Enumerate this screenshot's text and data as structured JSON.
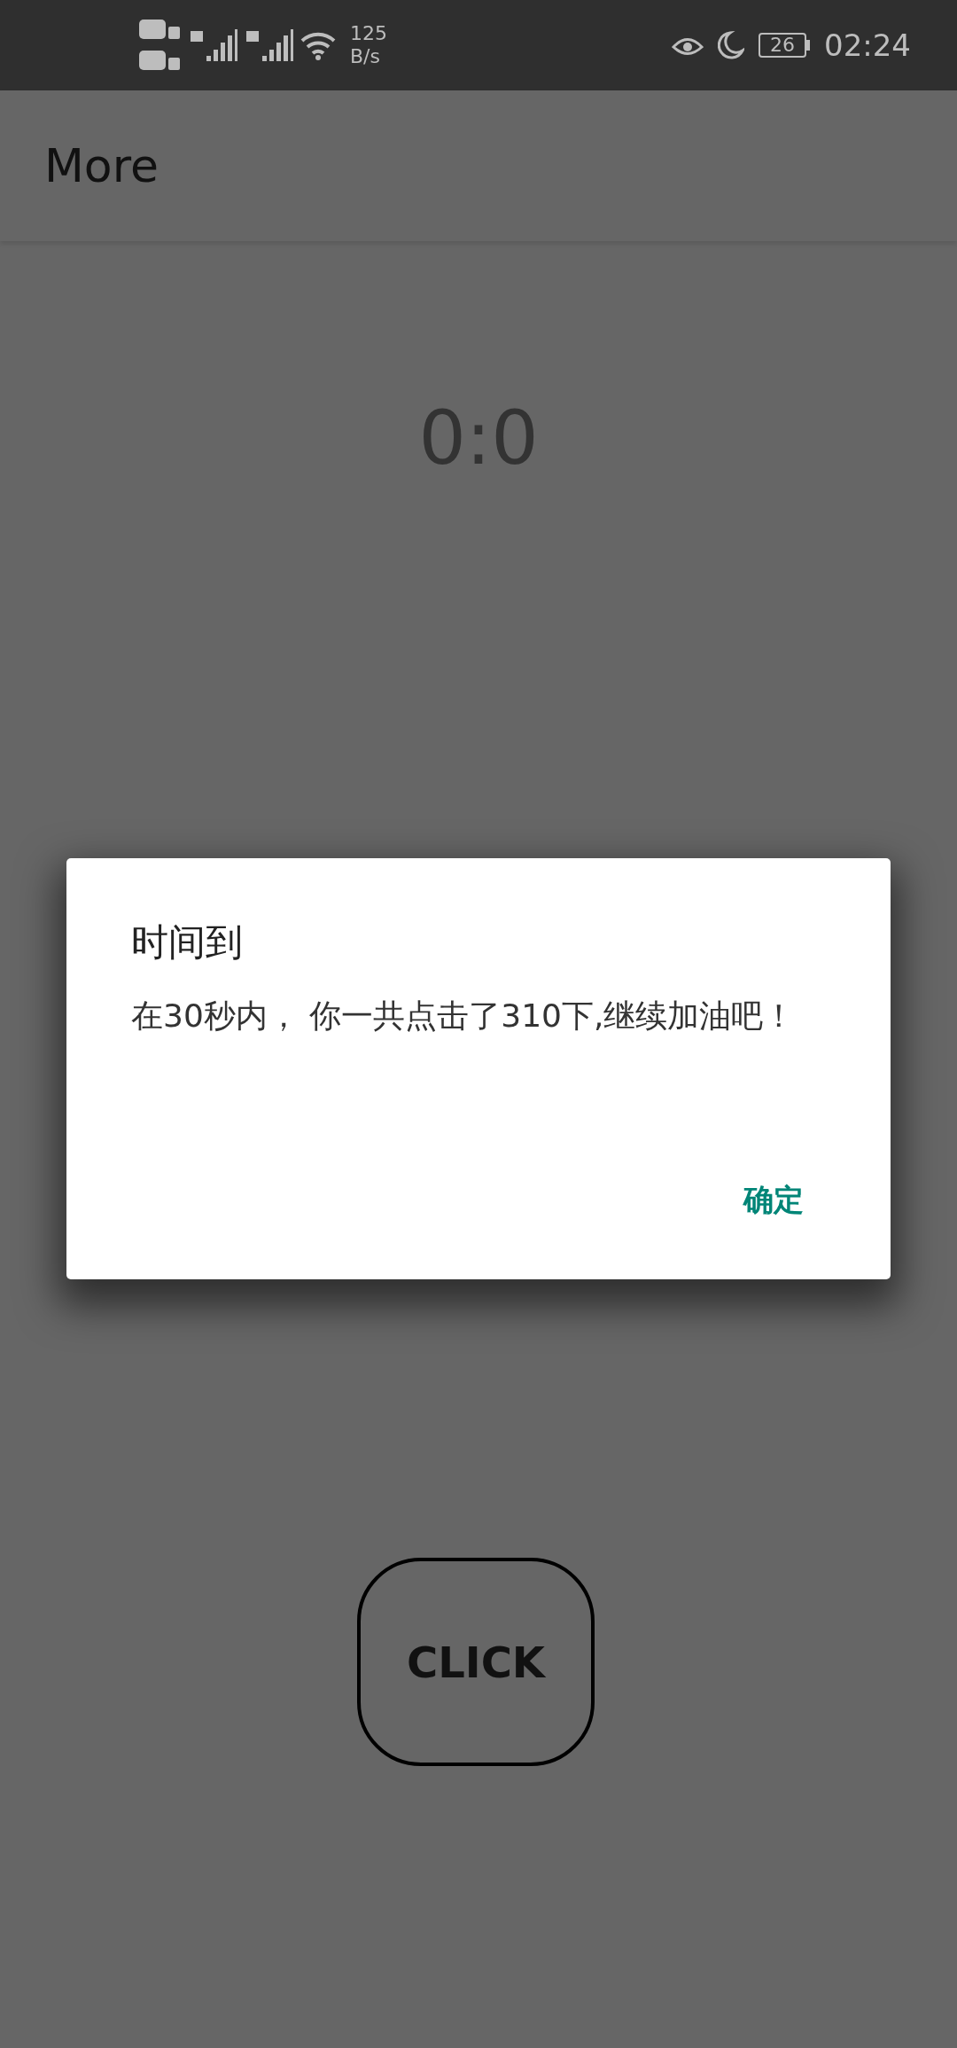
{
  "status_bar": {
    "net_speed": "125",
    "net_unit": "B/s",
    "battery": "26",
    "time": "02:24"
  },
  "app_bar": {
    "title": "More"
  },
  "score": "0:0",
  "click_button": {
    "label": "CLICK"
  },
  "dialog": {
    "title": "时间到",
    "message": "在30秒内， 你一共点击了310下,继续加油吧！",
    "buttons": [
      "确定"
    ]
  }
}
